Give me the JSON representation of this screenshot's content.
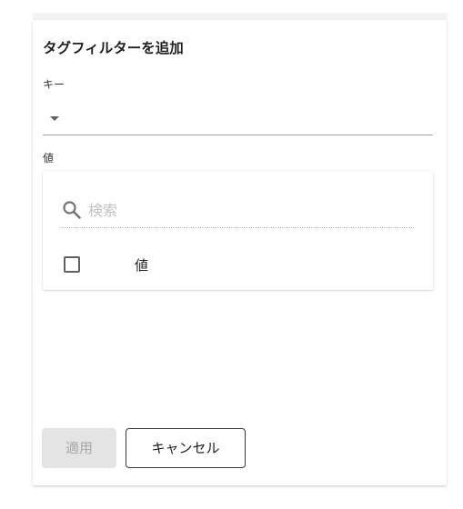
{
  "dialog": {
    "title": "タグフィルターを追加",
    "key": {
      "label": "キー",
      "selected": ""
    },
    "value": {
      "label": "値",
      "search": {
        "placeholder": "検索",
        "value": "",
        "icon": "search-icon"
      },
      "options": [
        {
          "label": "値",
          "checked": false
        }
      ]
    },
    "buttons": {
      "apply": "適用",
      "cancel": "キャンセル"
    }
  },
  "colors": {
    "text": "#212121",
    "placeholder": "#c2c2c2",
    "disabled_button_bg": "#e4e4e4",
    "disabled_button_text": "#a8a8a8",
    "divider": "#9e9e9e"
  }
}
